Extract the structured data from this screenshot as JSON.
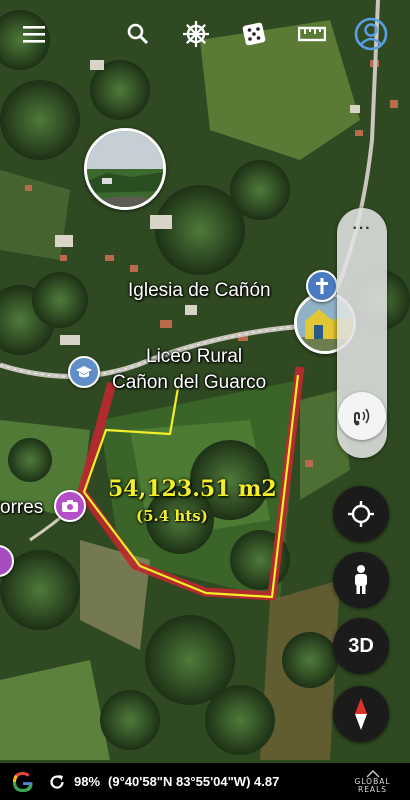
{
  "toolbar": {
    "items": [
      {
        "icon": "menu-icon"
      },
      {
        "icon": "search-icon"
      },
      {
        "icon": "ship-wheel-icon"
      },
      {
        "icon": "dice-icon"
      },
      {
        "icon": "ruler-icon"
      },
      {
        "icon": "account-icon"
      }
    ]
  },
  "map": {
    "places": {
      "church": "Iglesia de Cañón",
      "school_line1": "Liceo Rural",
      "school_line2": "Cañon del Guarco",
      "torres": "orres"
    },
    "annotation": {
      "area": "54,123.51 m2",
      "hectares": "(5.4 hts)",
      "outline_color": "#f2ef2a",
      "boundary_color": "#c0272d"
    }
  },
  "controls": {
    "zoom_menu": "···",
    "locate_icon": "crosshair-icon",
    "street_view_icon": "pegman-icon",
    "three_d": "3D",
    "compass_icon": "compass-icon",
    "sound_icon": "sound-icon"
  },
  "status_bar": {
    "google": "G",
    "battery": "98%",
    "coordinates": "(9°40'58\"N 83°55'04\"W) 4.87"
  },
  "watermark": {
    "line1": "GLOBAL",
    "line2": "REALS"
  }
}
